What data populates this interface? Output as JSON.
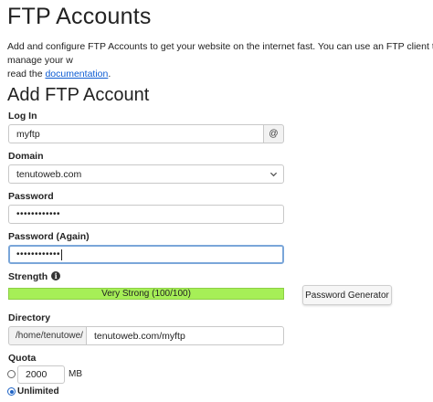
{
  "page": {
    "title": "FTP Accounts",
    "intro_text": "Add and configure FTP Accounts to get your website on the internet fast. You can use an FTP client to manage your w",
    "intro_text_2": "read the ",
    "doc_link": "documentation",
    "intro_end": "."
  },
  "form": {
    "section_title": "Add FTP Account",
    "login": {
      "label": "Log In",
      "value": "myftp",
      "addon": "@"
    },
    "domain": {
      "label": "Domain",
      "value": "tenutoweb.com"
    },
    "password": {
      "label": "Password",
      "value": "••••••••••••"
    },
    "password_again": {
      "label": "Password (Again)",
      "value": "••••••••••••"
    },
    "strength": {
      "label": "Strength",
      "info_icon": "i",
      "bar_text": "Very Strong (100/100)",
      "level_percent": 100,
      "bar_color": "#a6ef57"
    },
    "generator_button": "Password Generator",
    "directory": {
      "label": "Directory",
      "prefix": "/home/tenutowe/",
      "value": "tenutoweb.com/myftp"
    },
    "quota": {
      "label": "Quota",
      "value": "2000",
      "unit": "MB",
      "unlimited_label": "Unlimited",
      "selected": "unlimited"
    }
  }
}
